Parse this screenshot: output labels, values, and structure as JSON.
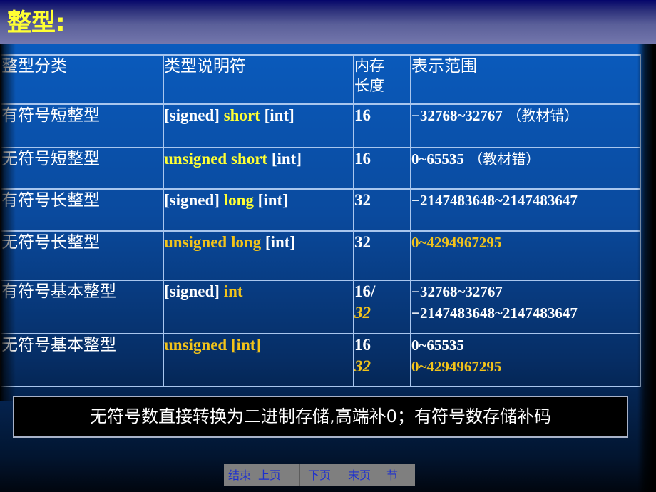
{
  "slide": {
    "title": "整型:",
    "colors": {
      "title": "#ffff33",
      "keyword_yellow": "#ffff33",
      "keyword_orange": "#f2c31a",
      "text": "#ffffff",
      "grid": "#a9c6ee"
    }
  },
  "table": {
    "headers": {
      "category": "整型分类",
      "specifier": "类型说明符",
      "size_line1": "内存",
      "size_line2": "长度",
      "range": "表示范围"
    },
    "rows": [
      {
        "category": "有符号短整型",
        "specifier": [
          {
            "text": "[signed] ",
            "style": "white"
          },
          {
            "text": "short",
            "style": "yellow"
          },
          {
            "text": " [int]",
            "style": "white"
          }
        ],
        "size": [
          "16"
        ],
        "range": [
          {
            "text": "−32768~32767",
            "note": " （教材错）",
            "style": "white"
          }
        ]
      },
      {
        "category": "无符号短整型",
        "specifier": [
          {
            "text": "unsigned short",
            "style": "yellow"
          },
          {
            "text": " [int]",
            "style": "white"
          }
        ],
        "size": [
          "16"
        ],
        "range": [
          {
            "text": "0~65535",
            "note": " （教材错）",
            "style": "white"
          }
        ]
      },
      {
        "category": "有符号长整型",
        "specifier": [
          {
            "text": "[signed] ",
            "style": "white"
          },
          {
            "text": "long",
            "style": "yellow"
          },
          {
            "text": " [int]",
            "style": "white"
          }
        ],
        "size": [
          "32"
        ],
        "range": [
          {
            "text": "−2147483648~2147483647",
            "style": "white"
          }
        ]
      },
      {
        "category": "无符号长整型",
        "specifier": [
          {
            "text": "unsigned long",
            "style": "orange"
          },
          {
            "text": " [int]",
            "style": "white"
          }
        ],
        "size": [
          "32"
        ],
        "range": [
          {
            "text": "0~4294967295",
            "style": "orange"
          }
        ]
      },
      {
        "category": "有符号基本整型",
        "specifier": [
          {
            "text": "[signed] ",
            "style": "white"
          },
          {
            "text": "int",
            "style": "orange"
          }
        ],
        "size": [
          "16/",
          "32"
        ],
        "range": [
          {
            "text": "−32768~32767",
            "style": "white"
          },
          {
            "text": "−2147483648~2147483647",
            "style": "white"
          }
        ]
      },
      {
        "category": "无符号基本整型",
        "specifier": [
          {
            "text": "unsigned [int]",
            "style": "orange"
          }
        ],
        "size": [
          "16",
          "32"
        ],
        "range": [
          {
            "text": "0~65535",
            "style": "white"
          },
          {
            "text": "0~4294967295",
            "style": "orange"
          }
        ]
      }
    ]
  },
  "note": "无符号数直接转换为二进制存储,高端补0；有符号数存储补码",
  "nav": {
    "end": "结束",
    "prev": "上页",
    "next": "下页",
    "last": "末页",
    "section": "节"
  }
}
